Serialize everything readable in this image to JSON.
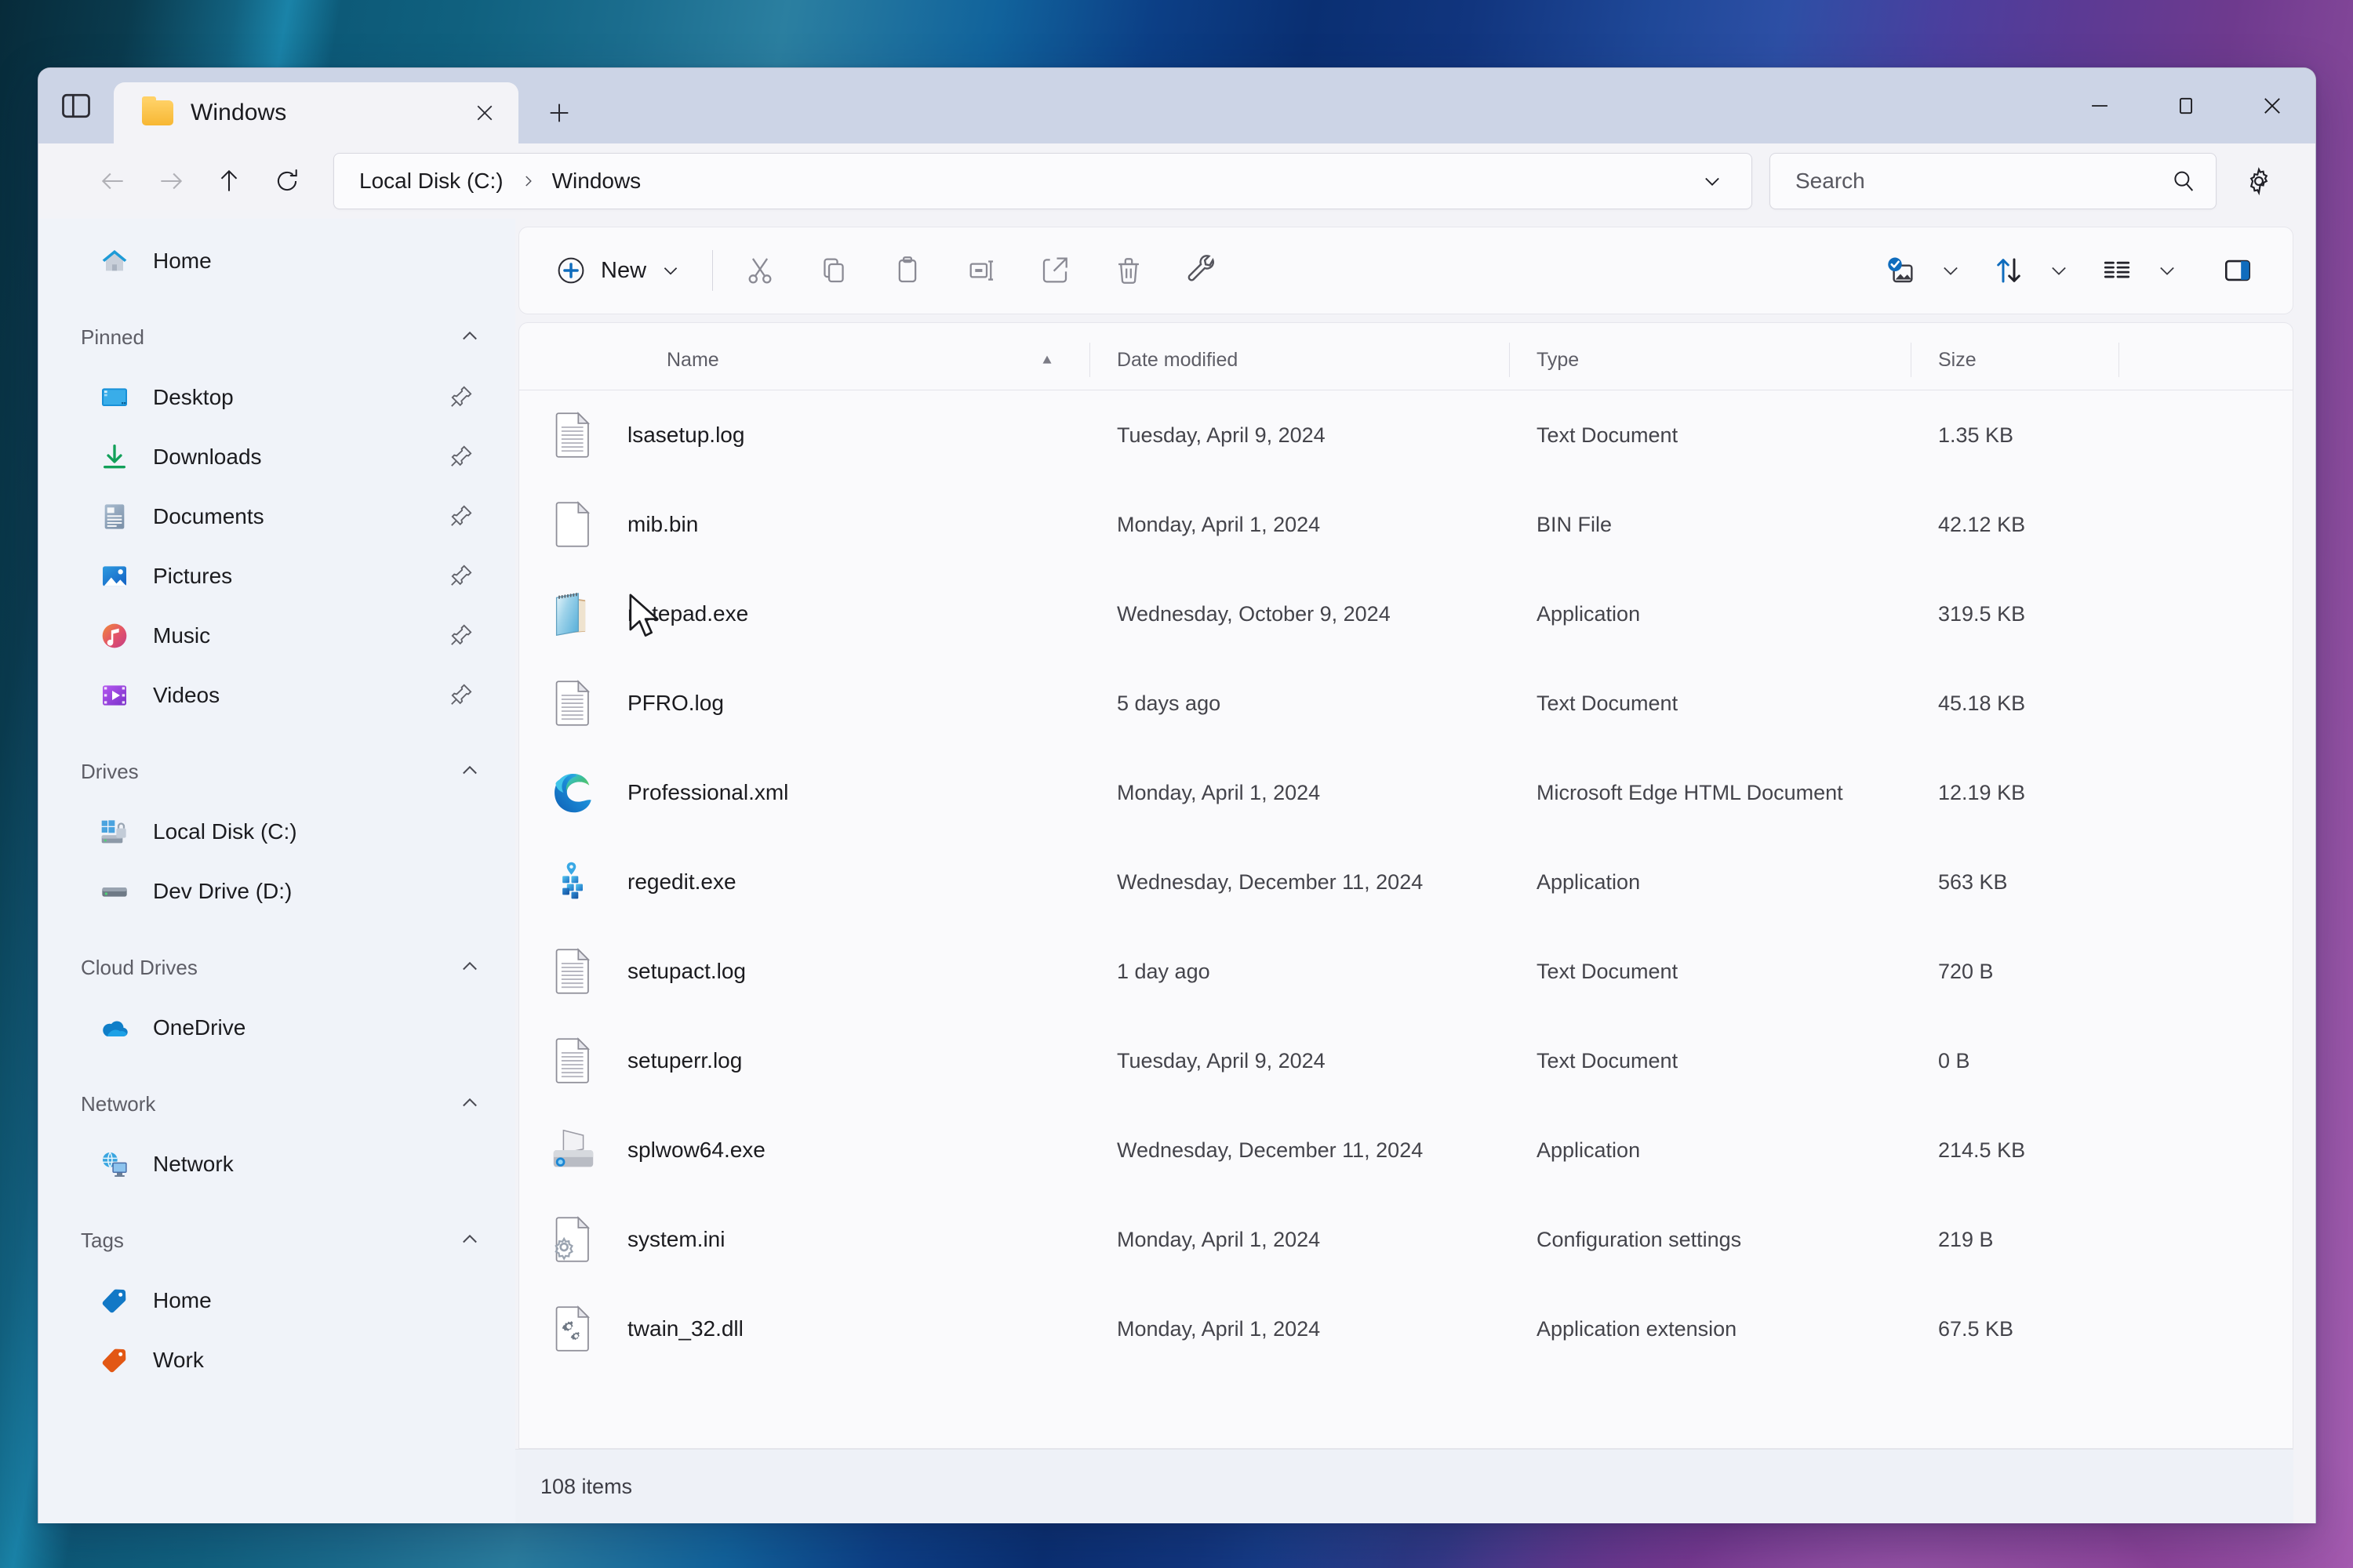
{
  "window": {
    "tab_title": "Windows",
    "controls": {
      "minimize": "Minimize",
      "maximize": "Maximize",
      "close": "Close"
    },
    "tab_strip_button": "Tab actions",
    "new_tab": "New tab",
    "tab_close": "Close tab"
  },
  "nav": {
    "back": "Back",
    "forward": "Forward",
    "up": "Up",
    "refresh": "Refresh"
  },
  "address": {
    "crumbs": [
      "Local Disk (C:)",
      "Windows"
    ],
    "dropdown": "Previous locations"
  },
  "search": {
    "placeholder": "Search",
    "value": ""
  },
  "settings_button": "See more",
  "toolbar": {
    "new_label": "New",
    "buttons": [
      {
        "name": "cut",
        "label": "Cut"
      },
      {
        "name": "copy",
        "label": "Copy"
      },
      {
        "name": "paste",
        "label": "Paste"
      },
      {
        "name": "rename",
        "label": "Rename"
      },
      {
        "name": "share",
        "label": "Share"
      },
      {
        "name": "delete",
        "label": "Delete"
      },
      {
        "name": "tools",
        "label": "Tools"
      }
    ],
    "view_options": "View options",
    "sort": "Sort",
    "layout": "Layout and view options",
    "details_pane": "Details pane"
  },
  "sidebar": {
    "home": {
      "label": "Home",
      "icon": "home-icon"
    },
    "groups": [
      {
        "label": "Pinned",
        "items": [
          {
            "label": "Desktop",
            "icon": "desktop-icon",
            "pinned": true
          },
          {
            "label": "Downloads",
            "icon": "downloads-icon",
            "pinned": true
          },
          {
            "label": "Documents",
            "icon": "documents-icon",
            "pinned": true
          },
          {
            "label": "Pictures",
            "icon": "pictures-icon",
            "pinned": true
          },
          {
            "label": "Music",
            "icon": "music-icon",
            "pinned": true
          },
          {
            "label": "Videos",
            "icon": "videos-icon",
            "pinned": true
          }
        ]
      },
      {
        "label": "Drives",
        "items": [
          {
            "label": "Local Disk (C:)",
            "icon": "drive-windows-icon",
            "pinned": false
          },
          {
            "label": "Dev Drive (D:)",
            "icon": "drive-icon",
            "pinned": false
          }
        ]
      },
      {
        "label": "Cloud Drives",
        "items": [
          {
            "label": "OneDrive",
            "icon": "onedrive-icon",
            "pinned": false
          }
        ]
      },
      {
        "label": "Network",
        "items": [
          {
            "label": "Network",
            "icon": "network-icon",
            "pinned": false
          }
        ]
      },
      {
        "label": "Tags",
        "items": [
          {
            "label": "Home",
            "icon": "tag-blue-icon",
            "pinned": false
          },
          {
            "label": "Work",
            "icon": "tag-orange-icon",
            "pinned": false
          }
        ]
      }
    ]
  },
  "filelist": {
    "columns": [
      {
        "key": "name",
        "label": "Name",
        "sort": "ascending"
      },
      {
        "key": "date",
        "label": "Date modified",
        "sort": null
      },
      {
        "key": "type",
        "label": "Type",
        "sort": null
      },
      {
        "key": "size",
        "label": "Size",
        "sort": null
      }
    ],
    "rows": [
      {
        "icon": "log-file-icon",
        "name": "lsasetup.log",
        "date": "Tuesday, April 9, 2024",
        "type": "Text Document",
        "size": "1.35 KB"
      },
      {
        "icon": "blank-file-icon",
        "name": "mib.bin",
        "date": "Monday, April 1, 2024",
        "type": "BIN File",
        "size": "42.12 KB"
      },
      {
        "icon": "notepad-icon",
        "name": "notepad.exe",
        "date": "Wednesday, October 9, 2024",
        "type": "Application",
        "size": "319.5 KB"
      },
      {
        "icon": "log-file-icon",
        "name": "PFRO.log",
        "date": "5 days ago",
        "type": "Text Document",
        "size": "45.18 KB"
      },
      {
        "icon": "edge-icon",
        "name": "Professional.xml",
        "date": "Monday, April 1, 2024",
        "type": "Microsoft Edge HTML Document",
        "size": "12.19 KB"
      },
      {
        "icon": "regedit-icon",
        "name": "regedit.exe",
        "date": "Wednesday, December 11, 2024",
        "type": "Application",
        "size": "563 KB"
      },
      {
        "icon": "log-file-icon",
        "name": "setupact.log",
        "date": "1 day ago",
        "type": "Text Document",
        "size": "720 B"
      },
      {
        "icon": "log-file-icon",
        "name": "setuperr.log",
        "date": "Tuesday, April 9, 2024",
        "type": "Text Document",
        "size": "0 B"
      },
      {
        "icon": "printer-icon",
        "name": "splwow64.exe",
        "date": "Wednesday, December 11, 2024",
        "type": "Application",
        "size": "214.5 KB"
      },
      {
        "icon": "ini-file-icon",
        "name": "system.ini",
        "date": "Monday, April 1, 2024",
        "type": "Configuration settings",
        "size": "219 B"
      },
      {
        "icon": "dll-file-icon",
        "name": "twain_32.dll",
        "date": "Monday, April 1, 2024",
        "type": "Application extension",
        "size": "67.5 KB"
      }
    ]
  },
  "statusbar": {
    "item_count": "108 items"
  },
  "colors": {
    "accent": "#0f6cbd",
    "window_bg": "#f3f3f7",
    "sidebar_bg": "#f0f3f9",
    "titlebar_bg": "#ccd4e6",
    "pane_bg": "#fafafc"
  }
}
